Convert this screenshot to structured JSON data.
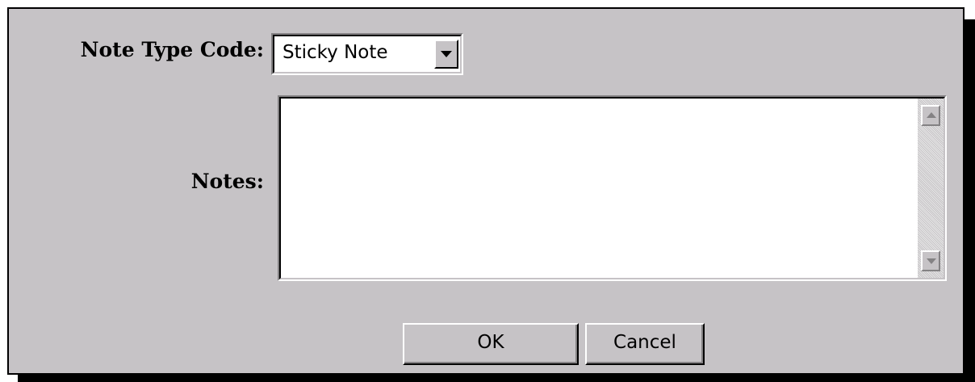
{
  "form": {
    "note_type_label": "Note Type Code:",
    "note_type_value": "Sticky Note",
    "notes_label": "Notes:",
    "notes_value": ""
  },
  "buttons": {
    "ok_label": "OK",
    "cancel_label": "Cancel"
  },
  "icons": {
    "dropdown": "chevron-down-icon",
    "scroll_up": "scroll-up-arrow-icon",
    "scroll_down": "scroll-down-arrow-icon"
  },
  "colors": {
    "dialog_background": "#c6c3c6",
    "field_background": "#ffffff",
    "shadow": "#000000"
  }
}
